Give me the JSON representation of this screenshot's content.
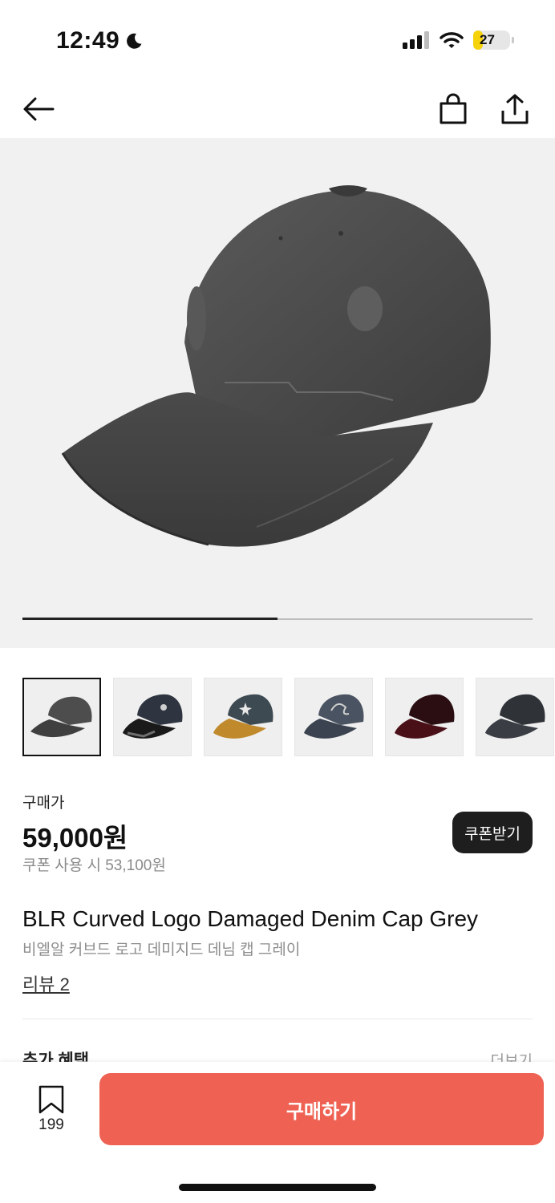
{
  "status_bar": {
    "time": "12:49",
    "battery_level": "27",
    "battery_fraction": 0.27,
    "icons": [
      "moon-icon",
      "signal-icon",
      "wifi-icon",
      "battery-icon"
    ]
  },
  "nav": {
    "icons": [
      "back-arrow-icon",
      "shopping-bag-icon",
      "share-icon"
    ]
  },
  "gallery": {
    "progress_fraction": 0.5,
    "thumbnails": [
      {
        "name": "grey-cap",
        "selected": true
      },
      {
        "name": "black-painted-cap",
        "selected": false
      },
      {
        "name": "washed-cap-with-yellow-brim",
        "selected": false
      },
      {
        "name": "navy-logo-cap",
        "selected": false
      },
      {
        "name": "burgundy-cap",
        "selected": false
      },
      {
        "name": "charcoal-cap",
        "selected": false
      }
    ]
  },
  "pricing": {
    "label": "구매가",
    "price": "59,000원",
    "coupon_price": "쿠폰 사용 시 53,100원",
    "coupon_button": "쿠폰받기"
  },
  "product": {
    "name": "BLR Curved Logo Damaged Denim Cap Grey",
    "name_ko": "비엘알 커브드 로고 데미지드 데님 캡 그레이",
    "review_link": "리뷰 2"
  },
  "benefits": {
    "title": "추가 혜택",
    "more": "더보기"
  },
  "bottom_bar": {
    "bookmark_count": "199",
    "buy_button": "구매하기"
  },
  "colors": {
    "buy_button": "#ef6253",
    "coupon_button": "#1e1e1e",
    "battery": "#f5d20a"
  }
}
